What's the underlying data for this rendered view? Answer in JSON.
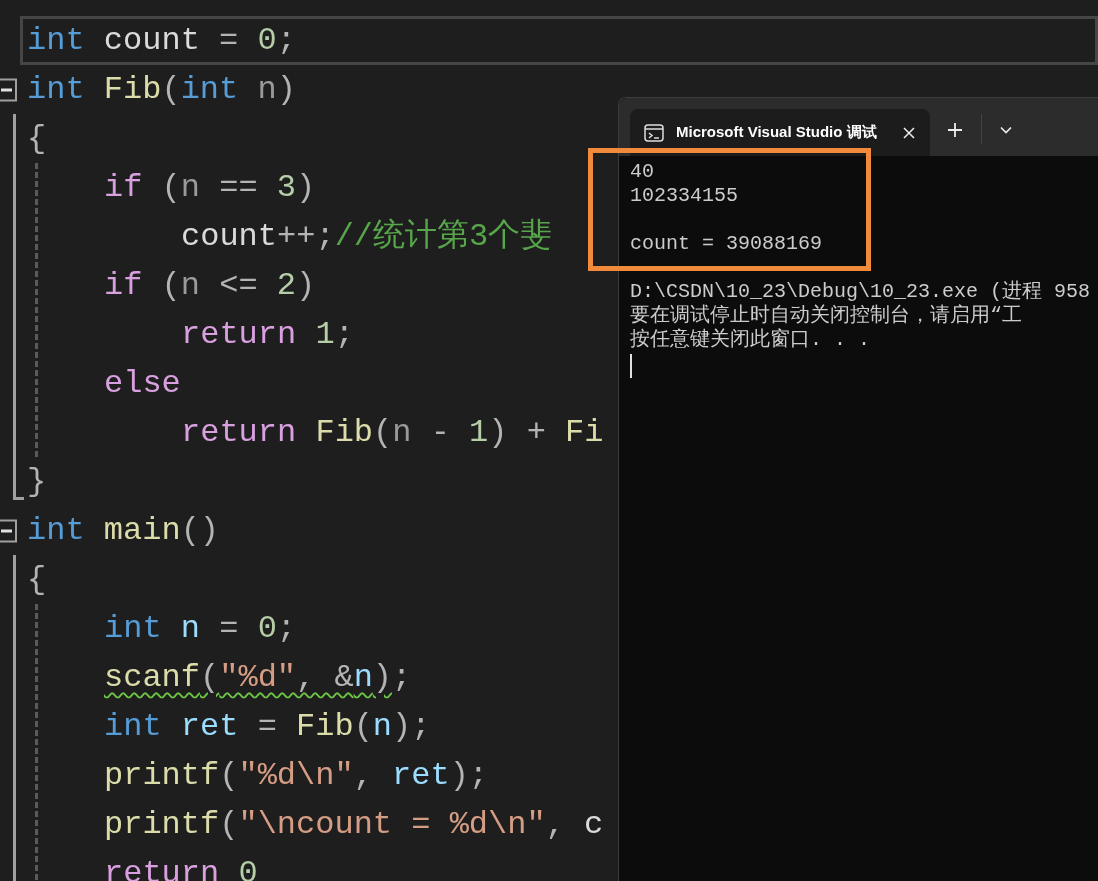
{
  "code": {
    "lines": [
      {
        "current": true,
        "tokens": [
          {
            "text": "int ",
            "kind": "keyword"
          },
          {
            "text": "count",
            "kind": "global"
          },
          {
            "text": " = ",
            "kind": "punct"
          },
          {
            "text": "0",
            "kind": "number"
          },
          {
            "text": ";",
            "kind": "punct"
          }
        ]
      },
      {
        "current": false,
        "expanded": true,
        "tokens": [
          {
            "text": "int ",
            "kind": "keyword"
          },
          {
            "text": "Fib",
            "kind": "func"
          },
          {
            "text": "(",
            "kind": "punct"
          },
          {
            "text": "int ",
            "kind": "keyword"
          },
          {
            "text": "n",
            "kind": "param"
          },
          {
            "text": ")",
            "kind": "punct"
          }
        ],
        "children": [
          {
            "tokens": [
              {
                "text": "{",
                "kind": "punct"
              }
            ],
            "children": [
              {
                "tokens": [
                  {
                    "text": "if",
                    "kind": "control"
                  },
                  {
                    "text": " (",
                    "kind": "punct"
                  },
                  {
                    "text": "n",
                    "kind": "param"
                  },
                  {
                    "text": " == ",
                    "kind": "punct"
                  },
                  {
                    "text": "3",
                    "kind": "number"
                  },
                  {
                    "text": ")",
                    "kind": "punct"
                  }
                ],
                "children": [
                  {
                    "tokens": [
                      {
                        "text": "count",
                        "kind": "global"
                      },
                      {
                        "text": "++;",
                        "kind": "punct"
                      },
                      {
                        "text": "//统计第3个斐",
                        "kind": "comment"
                      }
                    ]
                  }
                ]
              },
              {
                "tokens": [
                  {
                    "text": "if",
                    "kind": "control"
                  },
                  {
                    "text": " (",
                    "kind": "punct"
                  },
                  {
                    "text": "n",
                    "kind": "param"
                  },
                  {
                    "text": " <= ",
                    "kind": "punct"
                  },
                  {
                    "text": "2",
                    "kind": "number"
                  },
                  {
                    "text": ")",
                    "kind": "punct"
                  }
                ],
                "children": [
                  {
                    "tokens": [
                      {
                        "text": "return ",
                        "kind": "control"
                      },
                      {
                        "text": "1",
                        "kind": "number"
                      },
                      {
                        "text": ";",
                        "kind": "punct"
                      }
                    ]
                  }
                ]
              },
              {
                "tokens": [
                  {
                    "text": "else",
                    "kind": "control"
                  }
                ],
                "children": [
                  {
                    "tokens": [
                      {
                        "text": "return ",
                        "kind": "control"
                      },
                      {
                        "text": "Fib",
                        "kind": "func"
                      },
                      {
                        "text": "(",
                        "kind": "punct"
                      },
                      {
                        "text": "n",
                        "kind": "param"
                      },
                      {
                        "text": " - ",
                        "kind": "punct"
                      },
                      {
                        "text": "1",
                        "kind": "number"
                      },
                      {
                        "text": ") + ",
                        "kind": "punct"
                      },
                      {
                        "text": "Fi",
                        "kind": "func"
                      }
                    ]
                  }
                ]
              }
            ]
          },
          {
            "tokens": [
              {
                "text": "}",
                "kind": "punct"
              }
            ]
          }
        ]
      },
      {
        "current": false,
        "expanded": true,
        "tokens": [
          {
            "text": "int ",
            "kind": "keyword"
          },
          {
            "text": "main",
            "kind": "func"
          },
          {
            "text": "()",
            "kind": "punct"
          }
        ],
        "children": [
          {
            "tokens": [
              {
                "text": "{",
                "kind": "punct"
              }
            ],
            "children": [
              {
                "warning": false,
                "tokens": [
                  {
                    "text": "int ",
                    "kind": "keyword"
                  },
                  {
                    "text": "n",
                    "kind": "local"
                  },
                  {
                    "text": " = ",
                    "kind": "punct"
                  },
                  {
                    "text": "0",
                    "kind": "number"
                  },
                  {
                    "text": ";",
                    "kind": "punct"
                  }
                ]
              },
              {
                "warning": true,
                "tokens": [
                  {
                    "text": "scanf",
                    "kind": "func"
                  },
                  {
                    "text": "(",
                    "kind": "punct"
                  },
                  {
                    "text": "\"%d\"",
                    "kind": "string"
                  },
                  {
                    "text": ", &",
                    "kind": "punct"
                  },
                  {
                    "text": "n",
                    "kind": "local"
                  },
                  {
                    "text": ")",
                    "kind": "punct"
                  },
                  {
                    "text": ";",
                    "kind": "punct"
                  }
                ]
              },
              {
                "warning": false,
                "tokens": [
                  {
                    "text": "int ",
                    "kind": "keyword"
                  },
                  {
                    "text": "ret",
                    "kind": "local"
                  },
                  {
                    "text": " = ",
                    "kind": "punct"
                  },
                  {
                    "text": "Fib",
                    "kind": "func"
                  },
                  {
                    "text": "(",
                    "kind": "punct"
                  },
                  {
                    "text": "n",
                    "kind": "local"
                  },
                  {
                    "text": ");",
                    "kind": "punct"
                  }
                ]
              },
              {
                "warning": false,
                "tokens": [
                  {
                    "text": "printf",
                    "kind": "func"
                  },
                  {
                    "text": "(",
                    "kind": "punct"
                  },
                  {
                    "text": "\"%d\\n\"",
                    "kind": "string"
                  },
                  {
                    "text": ", ",
                    "kind": "punct"
                  },
                  {
                    "text": "ret",
                    "kind": "local"
                  },
                  {
                    "text": ");",
                    "kind": "punct"
                  }
                ]
              },
              {
                "warning": false,
                "tokens": [
                  {
                    "text": "printf",
                    "kind": "func"
                  },
                  {
                    "text": "(",
                    "kind": "punct"
                  },
                  {
                    "text": "\"\\ncount = %d\\n\"",
                    "kind": "string"
                  },
                  {
                    "text": ", ",
                    "kind": "punct"
                  },
                  {
                    "text": "c",
                    "kind": "global"
                  }
                ]
              },
              {
                "tokens": [
                  {
                    "text": "return ",
                    "kind": "control"
                  },
                  {
                    "text": "0",
                    "kind": "number"
                  }
                ]
              }
            ]
          }
        ]
      }
    ]
  },
  "console": {
    "tab": {
      "title": "Microsoft Visual Studio 调试",
      "selected": true
    },
    "highlighted_blocks": [
      [
        "40",
        "102334155"
      ],
      [
        "count = 39088169"
      ]
    ],
    "lines": [
      "D:\\CSDN\\10_23\\Debug\\10_23.exe (进程 958",
      "要在调试停止时自动关闭控制台，请启用“工",
      "按任意键关闭此窗口. . ."
    ],
    "cursor": true
  }
}
